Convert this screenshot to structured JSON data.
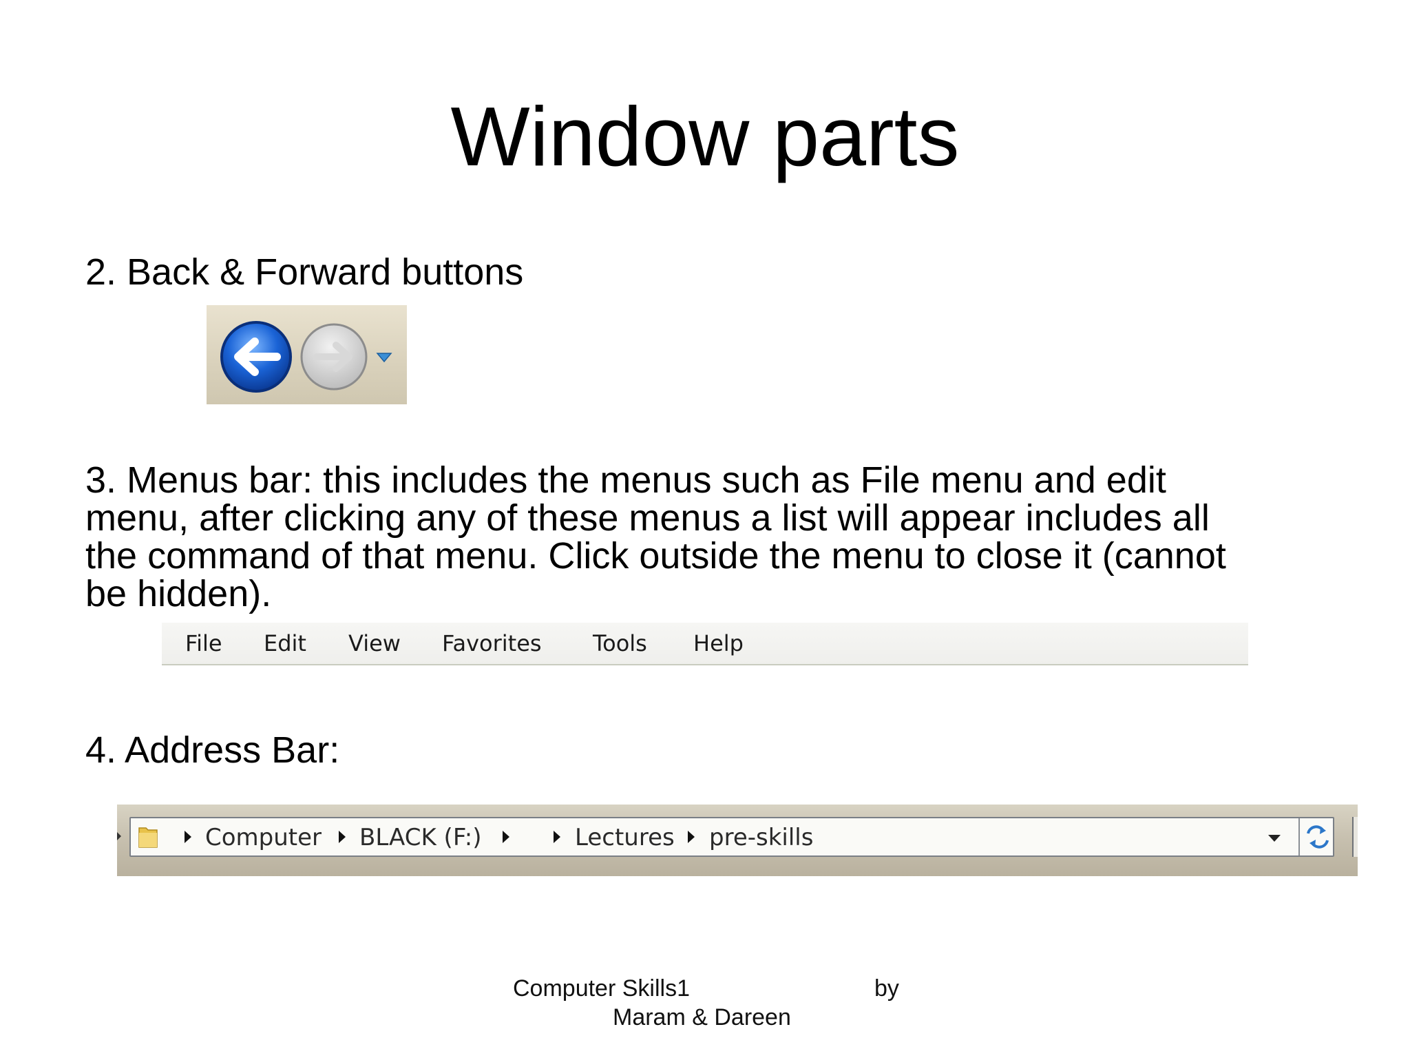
{
  "slide": {
    "title": "Window parts",
    "item2": "2. Back & Forward buttons",
    "item3_lines": [
      "3. Menus bar: this includes the menus such as File menu and edit",
      "menu, after clicking any of these menus a list will appear includes all",
      "the command of that menu. Click outside the menu to close it (cannot",
      "be hidden)."
    ],
    "item4": "4. Address Bar:"
  },
  "nav_buttons": {
    "back_icon": "back-arrow-icon",
    "forward_icon": "forward-arrow-icon",
    "dropdown_icon": "chevron-down-icon",
    "colors": {
      "back": "#1a63d6",
      "forward_disabled": "#c8c8c8",
      "dropdown": "#3b8fd6"
    }
  },
  "menubar": {
    "items": [
      "File",
      "Edit",
      "View",
      "Favorites",
      "Tools",
      "Help"
    ]
  },
  "addressbar": {
    "folder_icon": "folder-icon",
    "crumbs": [
      "Computer",
      "BLACK (F:)",
      "",
      "Lectures",
      "pre-skills"
    ],
    "dropdown_icon": "chevron-down-icon",
    "refresh_icon": "refresh-icon"
  },
  "footer": {
    "course": "Computer Skills1",
    "by": "by",
    "authors": "Maram & Dareen"
  }
}
